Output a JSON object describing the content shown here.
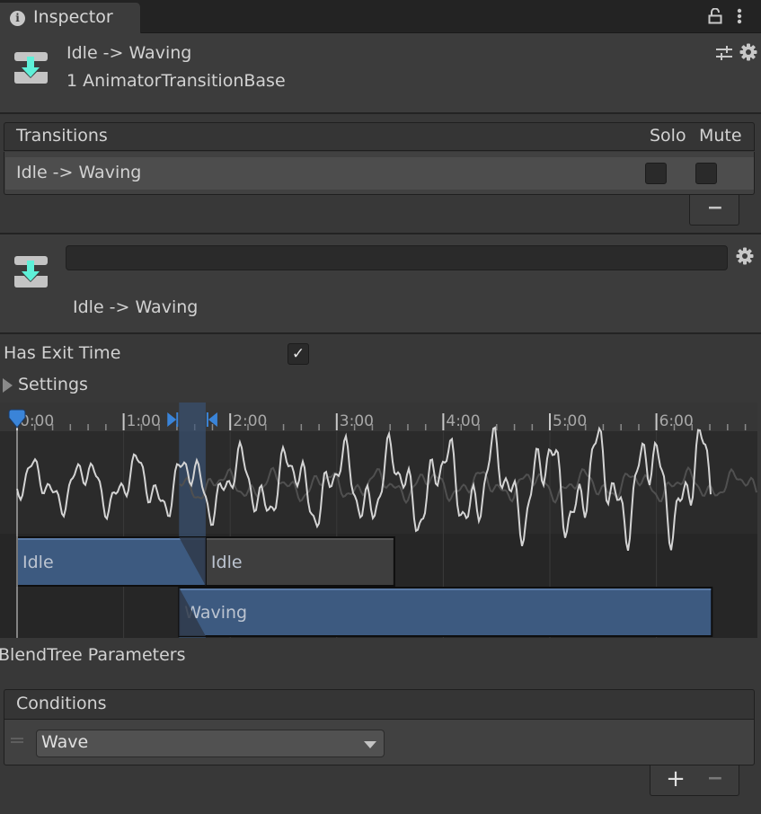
{
  "tab": {
    "label": "Inspector",
    "icon": "info-icon"
  },
  "tab_actions": {
    "lock_icon": "lock-open-icon",
    "menu_icon": "kebab-menu-icon"
  },
  "header": {
    "icon": "animator-transition-icon",
    "title": "Idle -> Waving",
    "subtitle": "1 AnimatorTransitionBase",
    "actions": [
      "presets-icon",
      "gear-icon"
    ]
  },
  "transitions": {
    "title": "Transitions",
    "solo_label": "Solo",
    "mute_label": "Mute",
    "rows": [
      {
        "label": "Idle -> Waving",
        "solo": false,
        "mute": false
      }
    ],
    "remove_label": "−"
  },
  "detail": {
    "name_value": "",
    "label": "Idle -> Waving"
  },
  "has_exit_time": {
    "label": "Has Exit Time",
    "checked": true,
    "check_glyph": "✓"
  },
  "settings": {
    "label": "Settings",
    "expanded": false
  },
  "timeline": {
    "ruler_labels": [
      "0:00",
      "1:00",
      "2:00",
      "3:00",
      "4:00",
      "5:00",
      "6:00"
    ],
    "ruler_range": [
      0,
      6.95
    ],
    "playhead": 0.0,
    "transition_start": 1.52,
    "transition_end": 1.77,
    "colors": {
      "accent": "#3a84d8",
      "clip_blue": "#3d5a80",
      "clip_gray": "#3e3e3e",
      "transition_band": "#3a5578"
    },
    "clips": [
      {
        "label": "Idle",
        "start": 0.0,
        "end": 1.77,
        "row": 0,
        "active": true
      },
      {
        "label": "Idle",
        "start": 1.77,
        "end": 3.54,
        "row": 0,
        "active": false
      },
      {
        "label": "Waving",
        "start": 1.52,
        "end": 6.52,
        "row": 1,
        "active": true
      }
    ]
  },
  "blendtree": {
    "label": "BlendTree Parameters"
  },
  "conditions": {
    "title": "Conditions",
    "items": [
      {
        "parameter": "Wave"
      }
    ],
    "add_label": "+",
    "remove_label": "−"
  }
}
